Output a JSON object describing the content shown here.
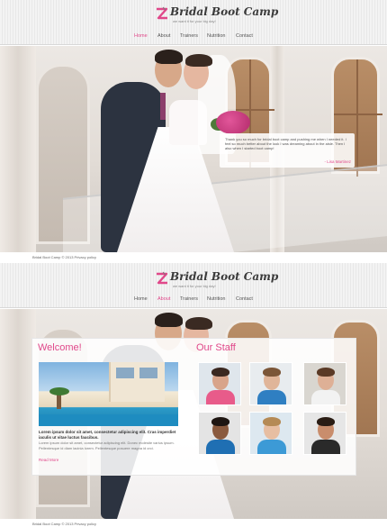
{
  "brand": {
    "name": "Bridal Boot Camp",
    "tagline": "we want it for your big day!",
    "accent_color": "#e0488a",
    "logo_icon": "logo-icon"
  },
  "nav": [
    "Home",
    "About",
    "Trainers",
    "Nutrition",
    "Contact"
  ],
  "page1": {
    "active_nav": "Home",
    "testimonial": {
      "text": "Thank you so much for bridal boot camp and pushing me when I needed it. I feel so much better about the look I was dreaming about in the aisle. Then I also when I started boot camp!",
      "author": "- Lisa Martinez"
    },
    "footer": {
      "copyright": "Bridal Boot Camp © 2013",
      "link": "Privacy policy"
    }
  },
  "page2": {
    "active_nav": "About",
    "welcome": {
      "title": "Welcome!",
      "lead": "Lorem ipsum dolor sit amet, consectetur adipiscing elit. Cras imperdiet iaculis ut vitae luctus faucibus.",
      "body": "Lorem ipsum dolor sit amet, consectetur adipiscing elit. Donec molestie varius ipsum. Pellentesque id diam lacinia lorem. Pellentesque posuere magna id orci.",
      "read_more": "Read More"
    },
    "staff": {
      "title": "Our Staff"
    },
    "footer": {
      "copyright": "Bridal Boot Camp © 2013",
      "link": "Privacy policy"
    }
  }
}
